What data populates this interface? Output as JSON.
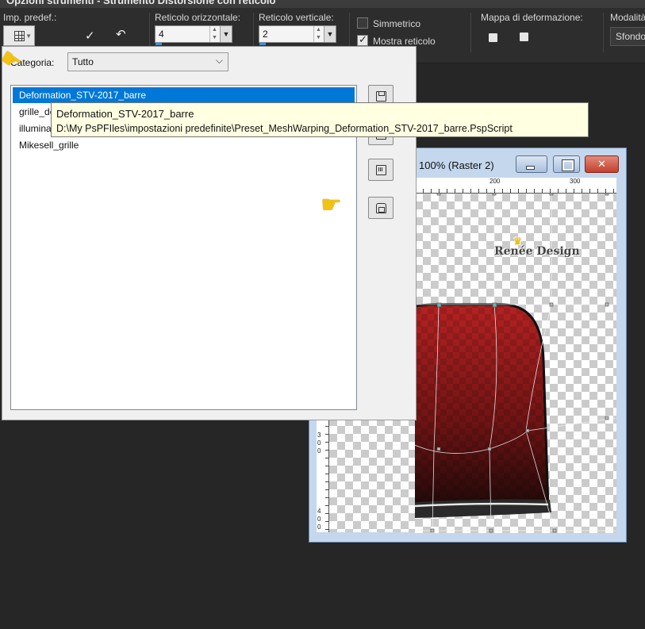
{
  "window_title": "Opzioni strumenti - Strumento Distorsione con reticolo",
  "toolbar": {
    "preset_label": "Imp. predef.:",
    "horizontal_label": "Reticolo orizzontale:",
    "horizontal_value": "4",
    "vertical_label": "Reticolo verticale:",
    "vertical_value": "2",
    "symmetric_label": "Simmetrico",
    "symmetric_checked": false,
    "show_grid_label": "Mostra reticolo",
    "show_grid_checked": true,
    "map_label": "Mappa di deformazione:",
    "mode_label": "Modalità",
    "mode_value": "Sfondo"
  },
  "dialog": {
    "category_label": "Categoria:",
    "category_value": "Tutto",
    "presets": [
      {
        "label": "Deformation_STV-2017_barre",
        "selected": true
      },
      {
        "label": "grille_deformante_tuto_tuiles",
        "selected": false
      },
      {
        "label": "illumination_grille_2017",
        "selected": false
      },
      {
        "label": "Mikesell_grille",
        "selected": false
      }
    ]
  },
  "tooltip": {
    "title": "Deformation_STV-2017_barre",
    "path": "D:\\My PsPFIles\\impostazioni predefinite\\Preset_MeshWarping_Deformation_STV-2017_barre.PspScript"
  },
  "image_window": {
    "title": "100% (Raster 2)",
    "ruler_top": [
      "200",
      "300"
    ],
    "ruler_left": [
      "3",
      "0",
      "0",
      "4",
      "0",
      "0"
    ]
  },
  "logo_text": "Renée Design",
  "colors": {
    "selection": "#0078d7",
    "tooltip_bg": "#ffffe1",
    "app_bg": "#262626",
    "shape_red": "#b02020",
    "pointer_hand": "#f3c312"
  }
}
